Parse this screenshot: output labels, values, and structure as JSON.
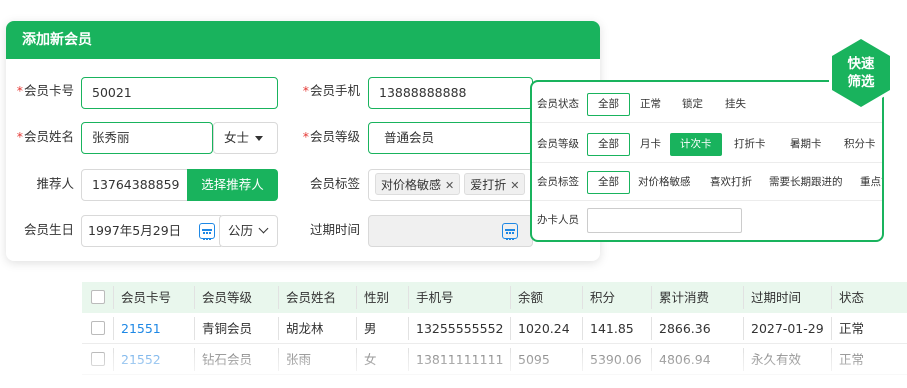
{
  "form": {
    "title": "添加新会员",
    "card_no_label": "会员卡号",
    "card_no_value": "50021",
    "phone_label": "会员手机",
    "phone_value": "13888888888",
    "name_label": "会员姓名",
    "name_value": "张秀丽",
    "title_select": "女士",
    "level_label": "会员等级",
    "level_value": "普通会员",
    "referrer_label": "推荐人",
    "referrer_value": "13764388859",
    "referrer_button": "选择推荐人",
    "tags_label": "会员标签",
    "tags": [
      "对价格敏感",
      "爱打折"
    ],
    "tag_remove_glyph": "✕",
    "birthday_label": "会员生日",
    "birthday_value": "1997年5月29日",
    "calendar_type": "公历",
    "expiry_label": "过期时间",
    "required_mark": "*"
  },
  "filter": {
    "badge_line1": "快速",
    "badge_line2": "筛选",
    "status_label": "会员状态",
    "status_options": [
      "全部",
      "正常",
      "锁定",
      "挂失"
    ],
    "level_label": "会员等级",
    "level_options": [
      "全部",
      "月卡",
      "计次卡",
      "打折卡",
      "暑期卡",
      "积分卡"
    ],
    "level_active": "计次卡",
    "tag_label": "会员标签",
    "tag_options": [
      "全部",
      "对价格敏感",
      "喜欢打折",
      "需要长期跟进的",
      "重点管"
    ],
    "agent_label": "办卡人员",
    "agent_value": ""
  },
  "table": {
    "headers": [
      "会员卡号",
      "会员等级",
      "会员姓名",
      "性别",
      "手机号",
      "余额",
      "积分",
      "累计消费",
      "过期时间",
      "状态"
    ],
    "rows": [
      [
        "21551",
        "青铜会员",
        "胡龙林",
        "男",
        "13255555552",
        "1020.24",
        "141.85",
        "2866.36",
        "2027-01-29",
        "正常"
      ],
      [
        "21552",
        "钻石会员",
        "张雨",
        "女",
        "13811111111",
        "5095",
        "5390.06",
        "4806.94",
        "永久有效",
        "正常"
      ]
    ]
  },
  "colors": {
    "brand_green": "#19b35d",
    "header_green_light": "#e9f7ed",
    "link_blue": "#1e88e5",
    "required_red": "#e53935"
  }
}
